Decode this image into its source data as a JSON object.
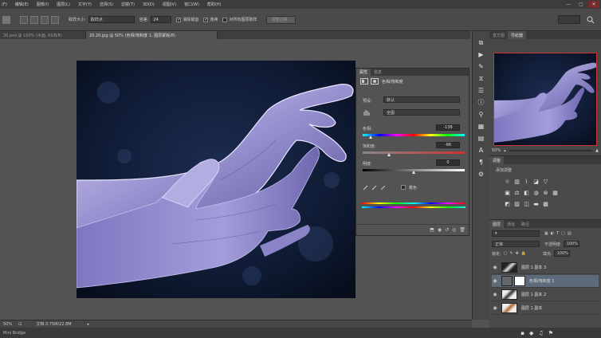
{
  "menubar": {
    "items": [
      "(F)",
      "编辑(E)",
      "图像(I)",
      "图层(L)",
      "文字(Y)",
      "选择(S)",
      "滤镜(T)",
      "3D(D)",
      "视图(V)",
      "窗口(W)",
      "帮助(H)"
    ],
    "controls": [
      "—",
      "▢",
      "✕"
    ]
  },
  "options": {
    "sample_size_label": "取样大小:",
    "sample_size_value": "取样点",
    "tolerance_label": "容差:",
    "tolerance_value": "24",
    "antialias_label": "消除锯齿",
    "contiguous_label": "连续",
    "all_layers_label": "对所有图层取样",
    "refine_button": "调整边缘..."
  },
  "doc_tabs": [
    "20.psd @ 100% (水面, RGB/8)",
    "20.20.jpg @ 50% (色相/饱和度 1, 图层蒙版/8)"
  ],
  "adjustments_panel": {
    "tabs": [
      "属性",
      "信息"
    ],
    "title": "色相/饱和度",
    "preset_label": "预设:",
    "preset_value": "默认",
    "channel_value": "全图",
    "hue_label": "色相:",
    "hue_value": "-138",
    "saturation_label": "饱和度:",
    "saturation_value": "-66",
    "lightness_label": "明度:",
    "lightness_value": "0",
    "colorize_label": "着色"
  },
  "navigator": {
    "tabs": [
      "直方图",
      "导航器"
    ],
    "zoom": "50%"
  },
  "adjustments": {
    "tabs": [
      "调整"
    ],
    "subtitle": "添加调整"
  },
  "layers_panel": {
    "tabs": [
      "图层",
      "通道",
      "路径"
    ],
    "blend_mode": "正常",
    "opacity_label": "不透明度:",
    "opacity_value": "100%",
    "lock_label": "锁定:",
    "fill_label": "填充:",
    "fill_value": "100%",
    "layers": [
      {
        "name": "图层 1 副本 3",
        "selected": false,
        "has_mask": false
      },
      {
        "name": "色相/饱和度 1",
        "selected": true,
        "has_mask": true
      },
      {
        "name": "图层 1 副本 2",
        "selected": false,
        "has_mask": false
      },
      {
        "name": "图层 1 副本",
        "selected": false,
        "has_mask": false
      }
    ]
  },
  "status": {
    "zoom": "50%",
    "doc_size": "文档:3.75M/22.8M"
  },
  "bottom": {
    "label": "Mini Bridge"
  },
  "colors": {
    "canvas_bg": "#0f1a30",
    "hand_tone": "#9a93d2",
    "selection_accent": "#5d6a7a"
  }
}
